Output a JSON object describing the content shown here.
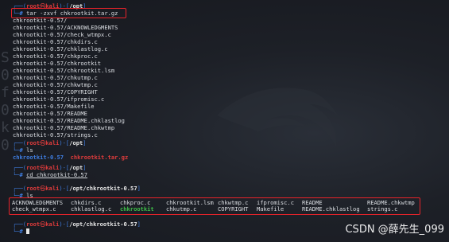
{
  "prompt": {
    "user": "root",
    "skull": "㉿",
    "host": "kali",
    "top_prefix": "┌──(",
    "top_mid": ")-[",
    "top_end": "]",
    "bottom": "└─",
    "hash": "# ",
    "hash_plain": "#"
  },
  "blocks": [
    {
      "path": "/opt",
      "command": "tar -zxvf chkrootkit.tar.gz"
    },
    {
      "path": "/opt",
      "command": "ls"
    },
    {
      "path": "/opt",
      "command": "cd chkrootkit-0.57"
    },
    {
      "path": "/opt/chkrootkit-0.57",
      "command": "ls"
    },
    {
      "path": "/opt/chkrootkit-0.57",
      "command": ""
    }
  ],
  "tar_output": [
    "chkrootkit-0.57/",
    "chkrootkit-0.57/ACKNOWLEDGMENTS",
    "chkrootkit-0.57/check_wtmpx.c",
    "chkrootkit-0.57/chkdirs.c",
    "chkrootkit-0.57/chklastlog.c",
    "chkrootkit-0.57/chkproc.c",
    "chkrootkit-0.57/chkrootkit",
    "chkrootkit-0.57/chkrootkit.lsm",
    "chkrootkit-0.57/chkutmp.c",
    "chkrootkit-0.57/chkwtmp.c",
    "chkrootkit-0.57/COPYRIGHT",
    "chkrootkit-0.57/ifpromisc.c",
    "chkrootkit-0.57/Makefile",
    "chkrootkit-0.57/README",
    "chkrootkit-0.57/README.chklastlog",
    "chkrootkit-0.57/README.chkwtmp",
    "chkrootkit-0.57/strings.c"
  ],
  "ls_opt": {
    "dir": "chkrootkit-0.57",
    "archive": "chkrootkit.tar.gz"
  },
  "ls_dir": {
    "row1": [
      "ACKNOWLEDGMENTS",
      "chkdirs.c",
      "chkproc.c",
      "chkrootkit.lsm",
      "chkwtmp.c",
      "ifpromisc.c",
      "README",
      "README.chkwtmp"
    ],
    "row2": [
      "check_wtmpx.c",
      "chklastlog.c",
      "chkrootkit",
      "chkutmp.c",
      "COPYRIGHT",
      "Makefile",
      "README.chklastlog",
      "strings.c"
    ]
  },
  "watermark": "CSDN @薛先生_099",
  "colors": {
    "accent_blue": "#3f7de0",
    "prompt_red": "#e03c3c",
    "highlight_box": "#e8232a",
    "exec_green": "#3fbf4a"
  }
}
